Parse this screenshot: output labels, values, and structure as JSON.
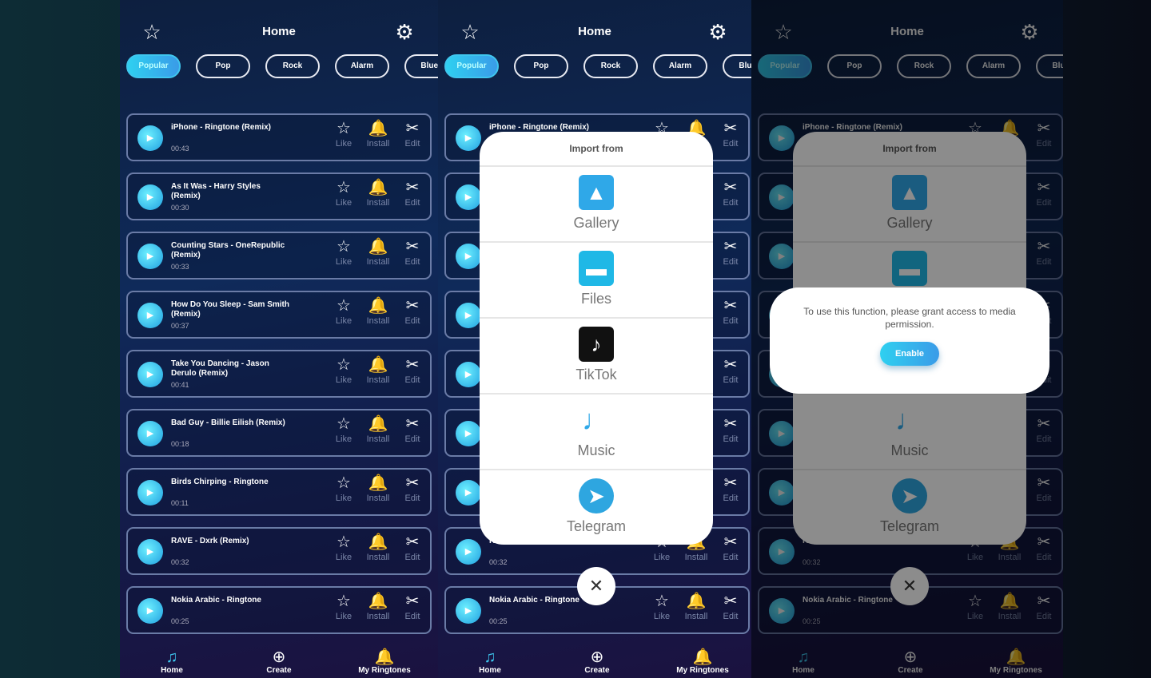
{
  "header": {
    "title": "Home",
    "favorites_icon": "star-icon",
    "settings_icon": "gear-icon"
  },
  "chips": [
    "Popular",
    "Pop",
    "Rock",
    "Alarm",
    "Blues"
  ],
  "songs": [
    {
      "title": "iPhone - Ringtone (Remix)",
      "duration": "00:43"
    },
    {
      "title": "As It Was - Harry Styles (Remix)",
      "duration": "00:30"
    },
    {
      "title": "Counting Stars - OneRepublic (Remix)",
      "duration": "00:33"
    },
    {
      "title": "How Do You Sleep - Sam Smith (Remix)",
      "duration": "00:37"
    },
    {
      "title": "Take You Dancing - Jason Derulo (Remix)",
      "duration": "00:41"
    },
    {
      "title": "Bad Guy - Billie Eilish (Remix)",
      "duration": "00:18"
    },
    {
      "title": "Birds Chirping - Ringtone",
      "duration": "00:11"
    },
    {
      "title": "RAVE - Dxrk (Remix)",
      "duration": "00:32"
    },
    {
      "title": "Nokia Arabic - Ringtone",
      "duration": "00:25"
    }
  ],
  "actions": {
    "like": "Like",
    "install": "Install",
    "edit": "Edit"
  },
  "nav": [
    {
      "label": "Home",
      "icon": "music-note-icon"
    },
    {
      "label": "Create",
      "icon": "plus-circle-icon"
    },
    {
      "label": "My Ringtones",
      "icon": "bell-icon"
    }
  ],
  "import": {
    "title": "Import from",
    "options": [
      {
        "label": "Gallery",
        "icon": "gallery-icon",
        "color": "#2fa8e8"
      },
      {
        "label": "Files",
        "icon": "folder-icon",
        "color": "#1fb8e6"
      },
      {
        "label": "TikTok",
        "icon": "tiktok-icon",
        "color": "#111111"
      },
      {
        "label": "Music",
        "icon": "music-note-icon",
        "color": "#ffffff"
      },
      {
        "label": "Telegram",
        "icon": "telegram-icon",
        "color": "#2ea6e0"
      }
    ]
  },
  "permission": {
    "message": "To use this function, please grant access to media permission.",
    "enable": "Enable"
  },
  "colors": {
    "accent": "#2fd0f0",
    "background": "#0f2a5a"
  }
}
